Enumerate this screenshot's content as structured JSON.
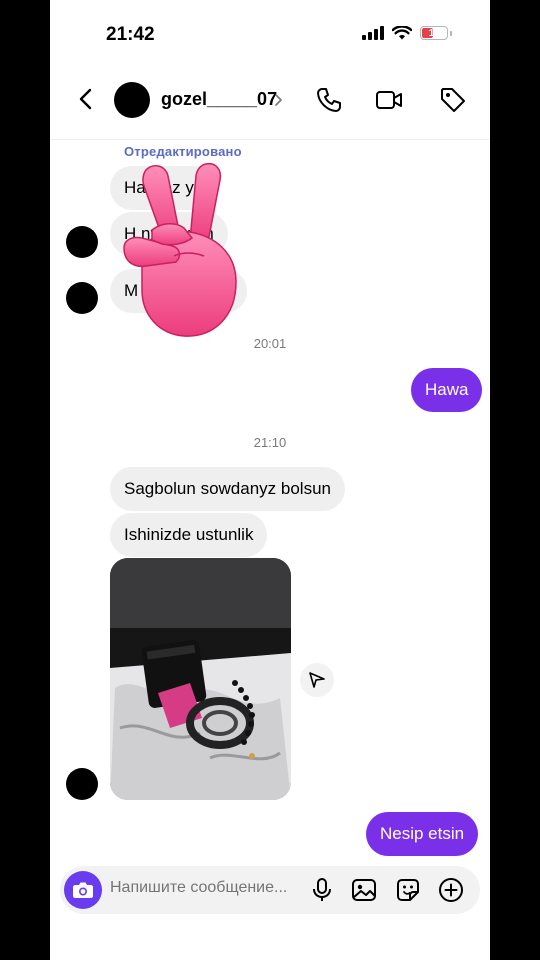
{
  "status_bar": {
    "time": "21:42",
    "battery": "11"
  },
  "header": {
    "username": "gozel_____07"
  },
  "messages": {
    "edited_label": "Отредактировано",
    "m1": "Haw   az   yn",
    "m2": "H         ny eyyam",
    "m3": "M              ka etdinizmi",
    "time1": "20:01",
    "out1": "Hawa",
    "time2": "21:10",
    "m4": "Sagbolun sowdanyz bolsun",
    "m5": "Ishinizde ustunlik",
    "out2": "Nesip etsin"
  },
  "composer": {
    "placeholder": "Напишите сообщение..."
  },
  "colors": {
    "accent": "#7a2fe8",
    "camera": "#6a3cf0",
    "edited": "#5b6bc4",
    "sticker": "#f2578f"
  },
  "icons": [
    "back-chevron-icon",
    "phone-icon",
    "video-camera-icon",
    "tag-icon",
    "camera-icon",
    "microphone-icon",
    "image-icon",
    "sticker-icon",
    "plus-icon",
    "share-send-icon"
  ]
}
